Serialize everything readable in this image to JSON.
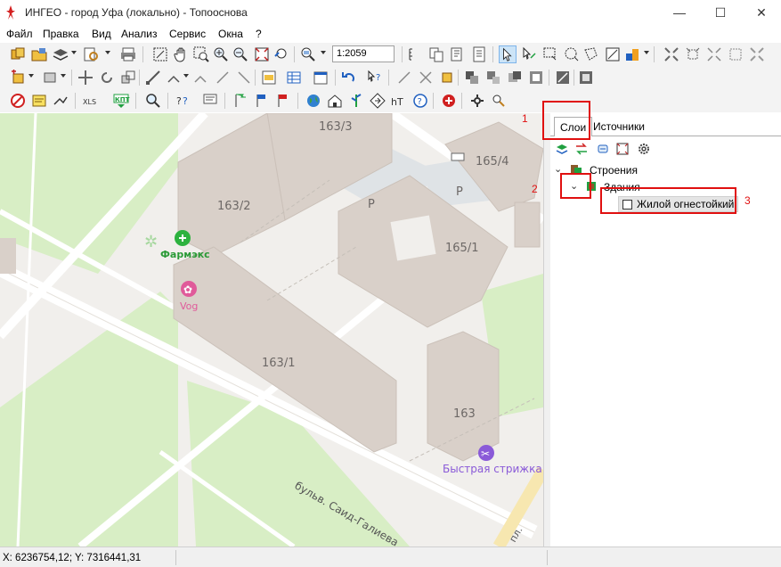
{
  "window": {
    "title": "ИНГЕО - город Уфа (локально) - Топооснова",
    "minimize": "—",
    "maximize": "☐",
    "close": "✕"
  },
  "menu": [
    "Файл",
    "Правка",
    "Вид",
    "Анализ",
    "Сервис",
    "Окна",
    "?"
  ],
  "toolbar": {
    "scale_value": "1:2059",
    "xls_label": "XLS",
    "kpt_label": "КПТ",
    "ht_label": "hT"
  },
  "map": {
    "labels": {
      "b163_3": "163/3",
      "b165_4": "165/4",
      "b163_2": "163/2",
      "b165_1": "165/1",
      "b163_1": "163/1",
      "b163": "163",
      "parking1": "P",
      "parking2": "P",
      "pharmacy": "Фармэкс",
      "vog": "Vog",
      "barber": "Быстрая стрижка",
      "street": "бульв. Саид-Галиева",
      "street2": "пл."
    },
    "colors": {
      "background": "#f1efec",
      "building": "#d9d0c9",
      "green": "#d8eec5",
      "road": "#ffffff",
      "parking": "#dfe3e6",
      "pharmacy": "#2db23f",
      "vog": "#e05a9a",
      "barber": "#8a5ad8"
    }
  },
  "panel": {
    "tabs": [
      "Слои",
      "Источники"
    ],
    "tree": {
      "group": "Строения",
      "sublayer": "Здания",
      "layer": "Жилой огнестойкий"
    }
  },
  "annotations": [
    "1",
    "2",
    "3"
  ],
  "annotation_color": "#e01010",
  "status": {
    "coords": "X: 6236754,12; Y: 7316441,31"
  }
}
